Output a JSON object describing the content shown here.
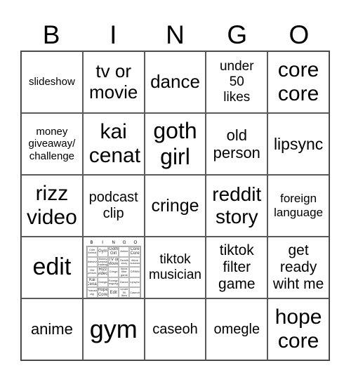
{
  "header": {
    "letters": [
      "B",
      "I",
      "N",
      "G",
      "O"
    ]
  },
  "cells": [
    [
      "slideshow",
      "tv or movie",
      "dance",
      "under 50 likes",
      "core core"
    ],
    [
      "money giveaway/ challenge",
      "kai cenat",
      "goth girl",
      "old person",
      "lipsync"
    ],
    [
      "rizz video",
      "podcast clip",
      "cringe",
      "reddit story",
      "foreign language"
    ],
    [
      "edit",
      "[bingo-card-image]",
      "tiktok musician",
      "tiktok filter game",
      "get ready wiht me"
    ],
    [
      "anime",
      "gym",
      "caseoh",
      "omegle",
      "hope core"
    ]
  ],
  "mini_card": {
    "letters": [
      "B",
      "I",
      "N",
      "G",
      "O"
    ],
    "cells": [
      [
        "Cute Animal",
        "Gym",
        "Goth Girl",
        "Anime",
        "Core Core"
      ],
      [
        "Slideshow",
        "Money giveaway/ Challenge",
        "TV or Movie",
        "Reddit story",
        "tiktok musician"
      ],
      [
        "Old person",
        "Rizz video",
        "Cringe",
        "tiktok filter game",
        "GRWM"
      ],
      [
        "Kai Cenat",
        "Omegle",
        "Foreign language",
        "Dance",
        "Lipsync"
      ],
      [
        "Podcast clip",
        "Hope Core",
        "Edit",
        "Under 50 likes",
        "Caseoh"
      ]
    ]
  }
}
